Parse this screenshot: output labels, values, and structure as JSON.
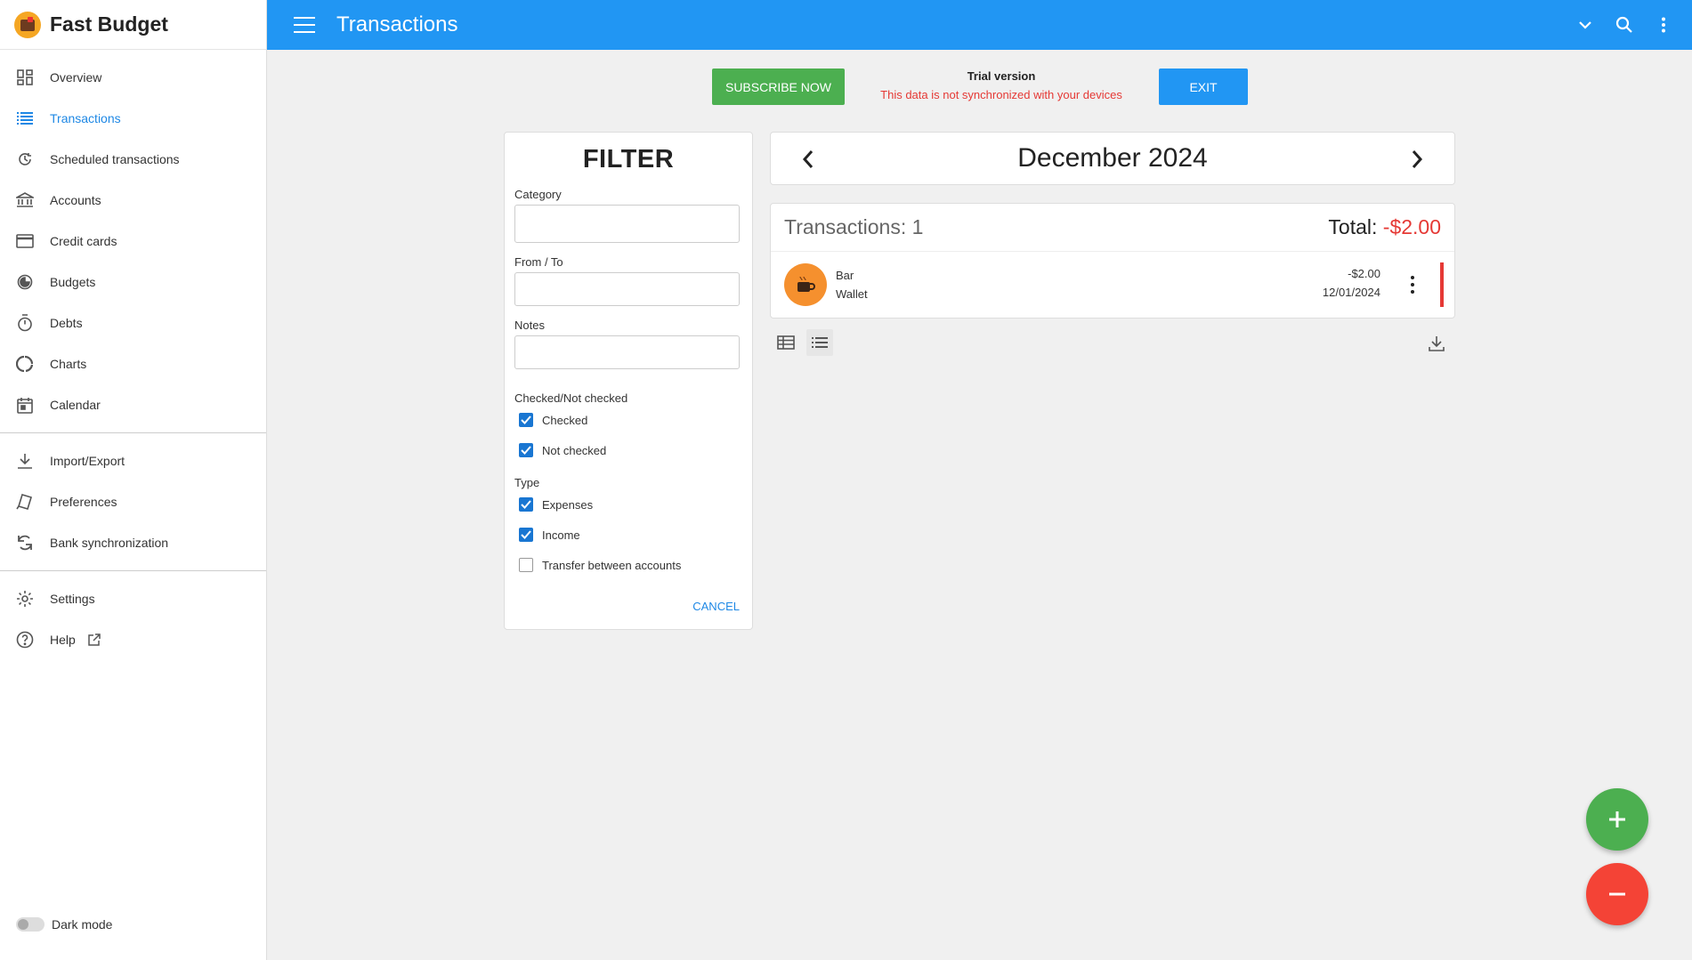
{
  "app": {
    "name": "Fast Budget"
  },
  "header": {
    "title": "Transactions"
  },
  "sidebar": {
    "items": [
      {
        "label": "Overview",
        "icon": "dashboard-icon"
      },
      {
        "label": "Transactions",
        "icon": "list-icon",
        "active": true
      },
      {
        "label": "Scheduled transactions",
        "icon": "schedule-icon"
      },
      {
        "label": "Accounts",
        "icon": "bank-icon"
      },
      {
        "label": "Credit cards",
        "icon": "credit-card-icon"
      },
      {
        "label": "Budgets",
        "icon": "budget-icon"
      },
      {
        "label": "Debts",
        "icon": "timer-icon"
      },
      {
        "label": "Charts",
        "icon": "chart-ring-icon"
      },
      {
        "label": "Calendar",
        "icon": "calendar-icon"
      },
      {
        "label": "Import/Export",
        "icon": "download-icon"
      },
      {
        "label": "Preferences",
        "icon": "preferences-icon"
      },
      {
        "label": "Bank synchronization",
        "icon": "sync-icon"
      },
      {
        "label": "Settings",
        "icon": "gear-icon"
      },
      {
        "label": "Help",
        "icon": "help-icon"
      }
    ],
    "dark_mode_label": "Dark mode"
  },
  "trial": {
    "subscribe_label": "SUBSCRIBE NOW",
    "title": "Trial version",
    "message": "This data is not synchronized with your devices",
    "exit_label": "EXIT"
  },
  "filter": {
    "title": "FILTER",
    "category_label": "Category",
    "category_value": "",
    "from_to_label": "From / To",
    "from_to_value": "",
    "notes_label": "Notes",
    "notes_value": "",
    "checked_section": "Checked/Not checked",
    "checked_label": "Checked",
    "checked": true,
    "not_checked_label": "Not checked",
    "not_checked": true,
    "type_section": "Type",
    "expenses_label": "Expenses",
    "expenses": true,
    "income_label": "Income",
    "income": true,
    "transfer_label": "Transfer between accounts",
    "transfer": false,
    "cancel_label": "CANCEL"
  },
  "month": {
    "label": "December 2024"
  },
  "transactions": {
    "count_label": "Transactions: 1",
    "total_label": "Total:",
    "total_value": "-$2.00",
    "rows": [
      {
        "category": "Bar",
        "account": "Wallet",
        "amount": "-$2.00",
        "date": "12/01/2024",
        "icon": "coffee-icon",
        "color": "#f5902e"
      }
    ]
  },
  "colors": {
    "primary": "#2196f3",
    "subscribe": "#4caf50",
    "negative": "#e53935",
    "fab_add": "#4caf50",
    "fab_subtract": "#f44336"
  }
}
